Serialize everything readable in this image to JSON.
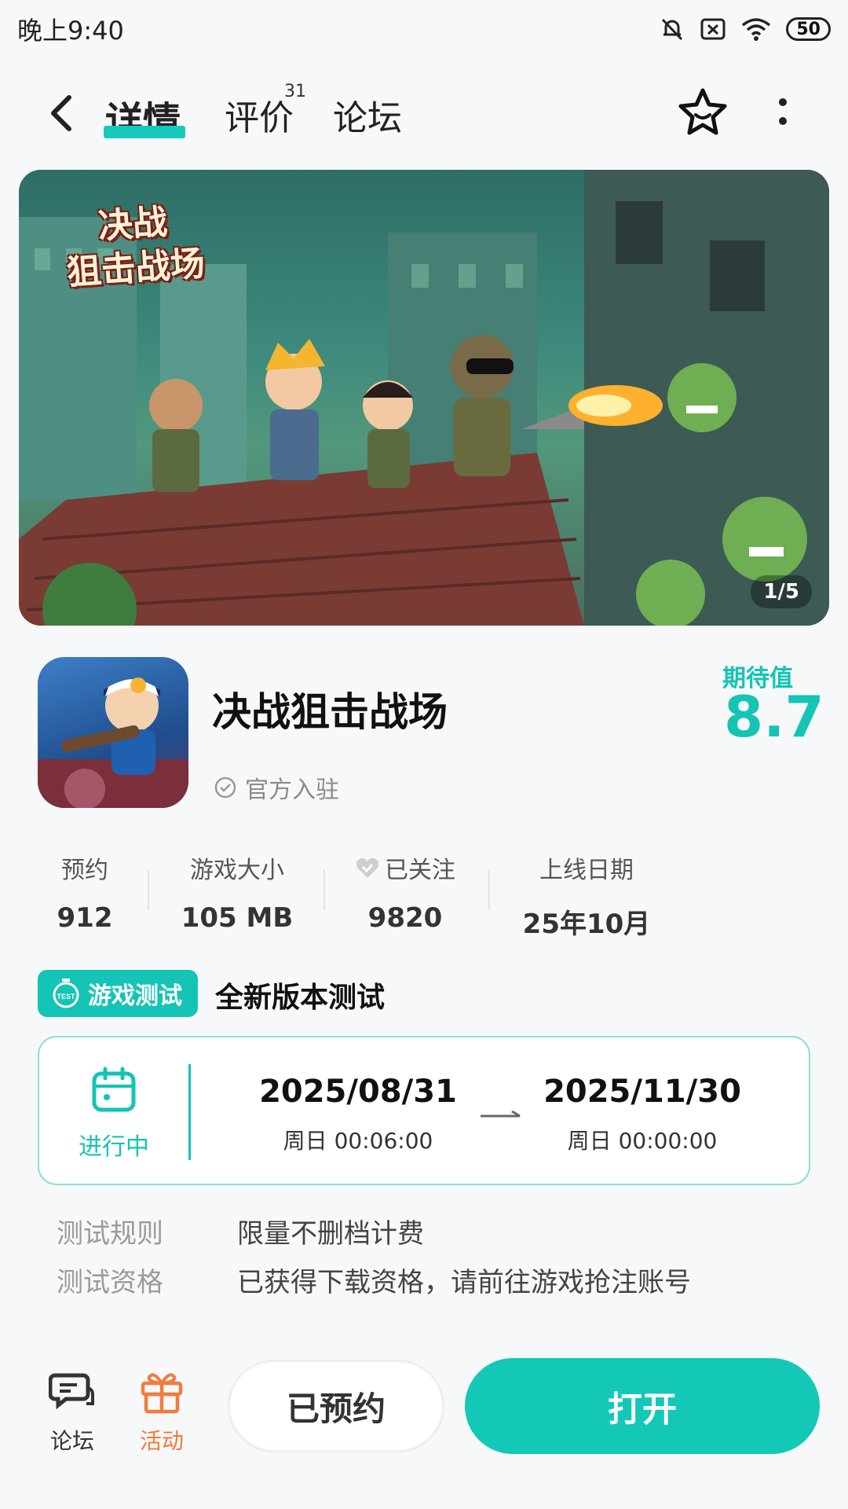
{
  "status_bar": {
    "time": "晚上9:40",
    "battery": "50",
    "icons": [
      "mute-bell-icon",
      "sim-off-icon",
      "wifi-icon"
    ]
  },
  "nav": {
    "tabs": [
      {
        "label": "详情",
        "active": true
      },
      {
        "label": "评价",
        "badge": "31"
      },
      {
        "label": "论坛"
      }
    ],
    "icons": [
      "back-arrow-icon",
      "star-favorite-icon",
      "more-vertical-icon"
    ]
  },
  "banner": {
    "logo_text": "决战\n狙击战场",
    "pager": "1/5"
  },
  "app": {
    "name": "决战狙击战场",
    "official": "官方入驻",
    "expect_label": "期待值",
    "expect_value": "8.7"
  },
  "stats": [
    {
      "label": "预约",
      "value": "912"
    },
    {
      "label": "游戏大小",
      "value": "105 MB"
    },
    {
      "label": "已关注",
      "value": "9820"
    },
    {
      "label": "上线日期",
      "value": "25年10月"
    }
  ],
  "test": {
    "tag": "游戏测试",
    "tag_icon_text": "TEST",
    "title": "全新版本测试",
    "status": "进行中",
    "start_date": "2025/08/31",
    "start_time": "周日  00:06:00",
    "end_date": "2025/11/30",
    "end_time": "周日  00:00:00",
    "rules": [
      {
        "key": "测试规则",
        "value": "限量不删档计费"
      },
      {
        "key": "测试资格",
        "value": "已获得下载资格，请前往游戏抢注账号"
      }
    ]
  },
  "bottom": {
    "forum": "论坛",
    "activity": "活动",
    "reserved_button": "已预约",
    "open_button": "打开"
  },
  "colors": {
    "accent": "#14c4b4",
    "activity": "#f07c3c"
  }
}
